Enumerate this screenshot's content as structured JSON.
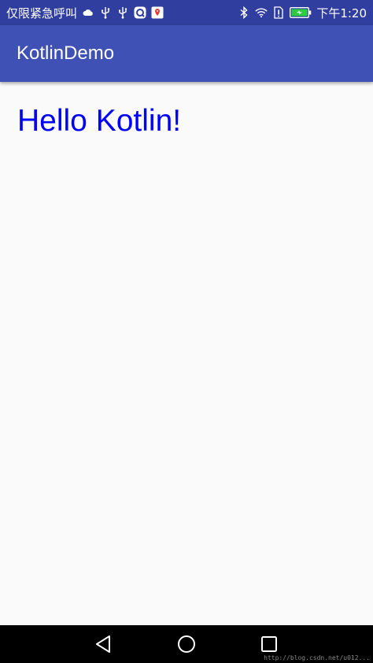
{
  "status_bar": {
    "carrier": "仅限紧急呼叫",
    "time": "下午1:20",
    "icons": [
      "cloud-icon",
      "usb-icon",
      "usb-icon",
      "q-app-icon",
      "map-pin-app-icon",
      "bluetooth-icon",
      "wifi-icon",
      "sim-alert-icon",
      "battery-charging-icon"
    ]
  },
  "app_bar": {
    "title": "KotlinDemo"
  },
  "content": {
    "hello": "Hello Kotlin!"
  },
  "nav_bar": {
    "buttons": [
      "back-icon",
      "home-icon",
      "recents-icon"
    ],
    "watermark": "http://blog.csdn.net/u012..."
  },
  "colors": {
    "status_bar": "#303f9f",
    "app_bar": "#3f51b5",
    "hello_text": "#0000ff",
    "battery": "#2ecc40",
    "background": "#fafafa"
  }
}
